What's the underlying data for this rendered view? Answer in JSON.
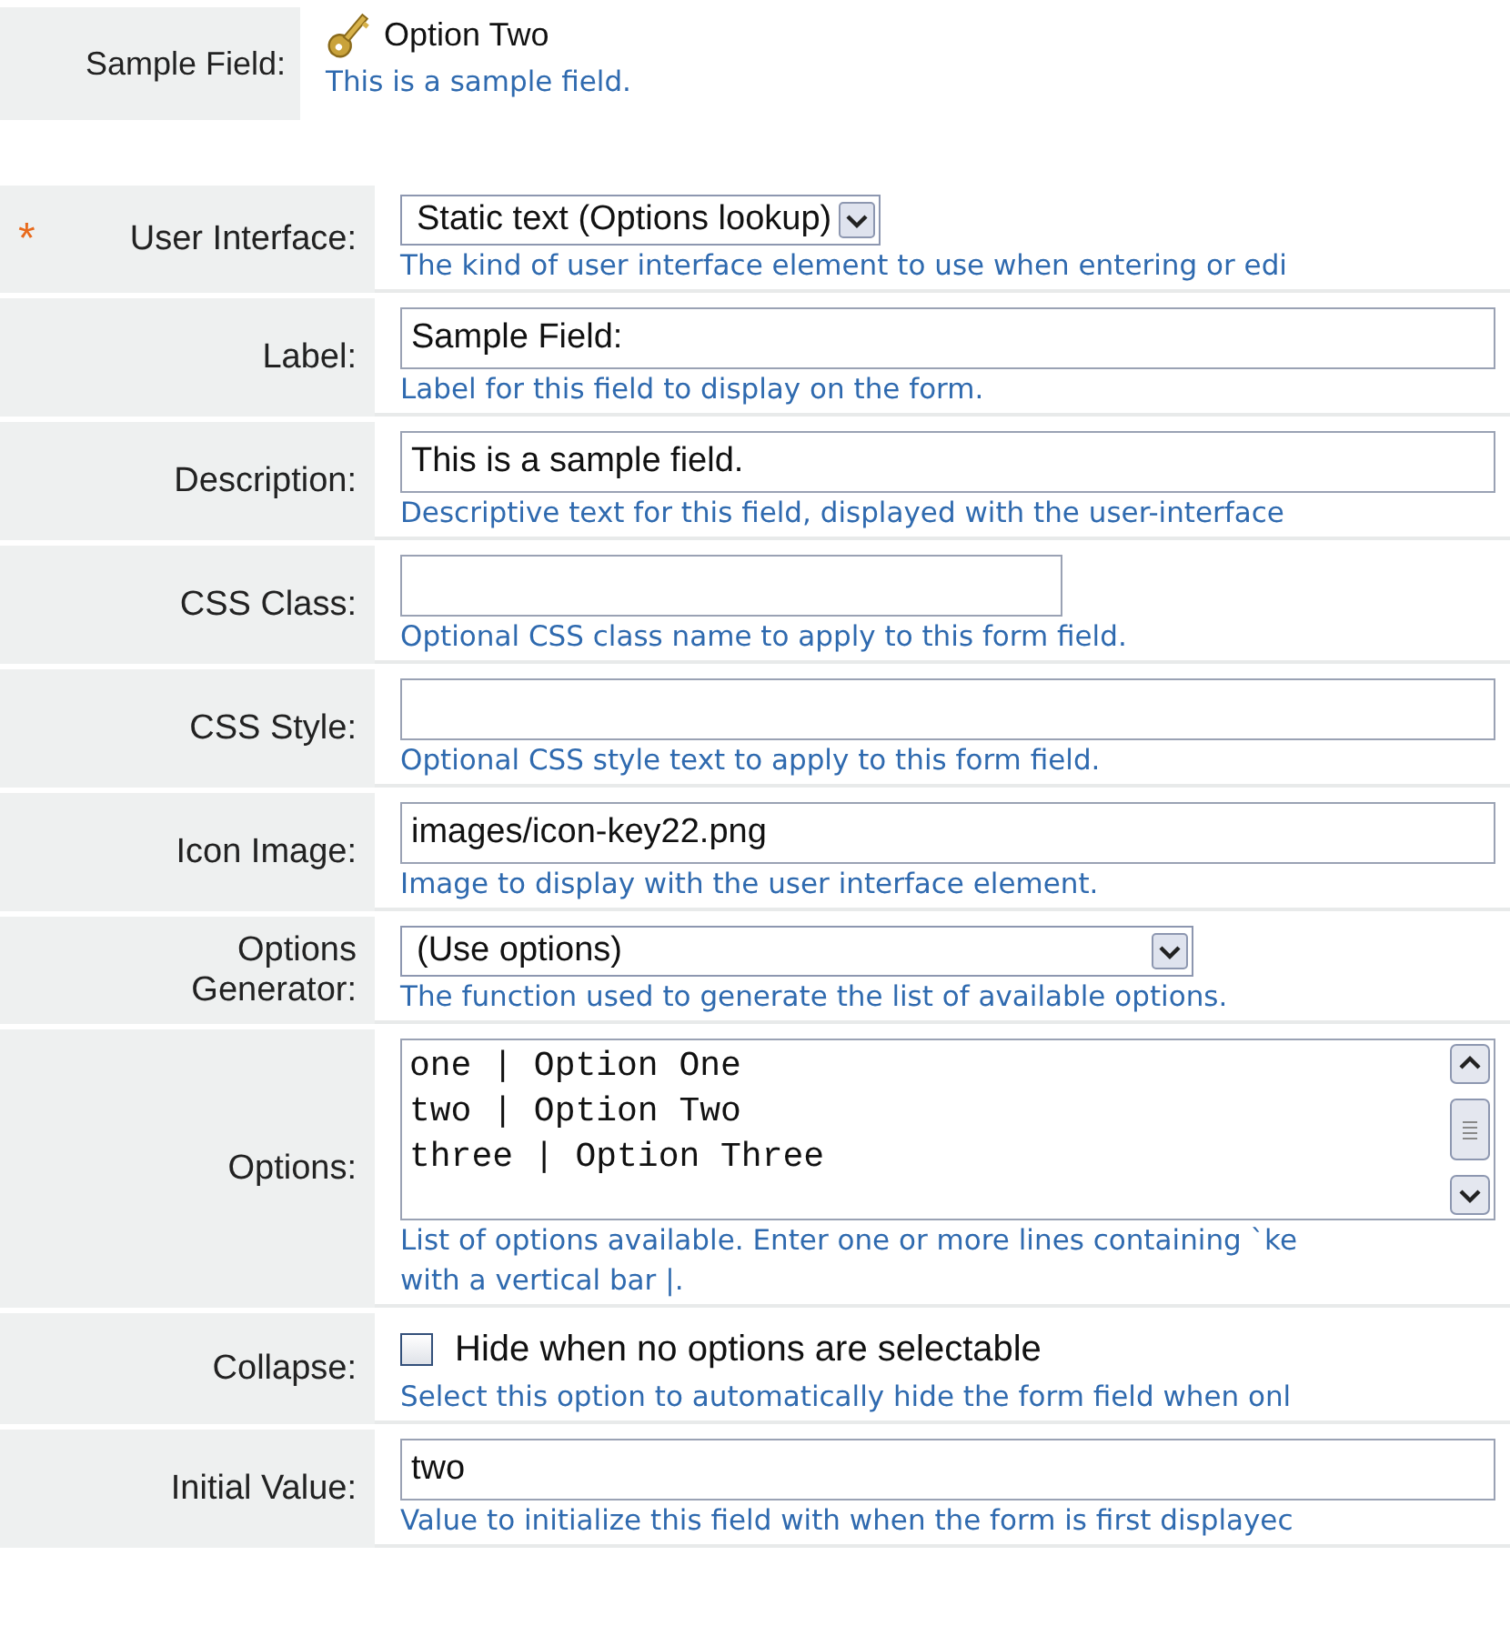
{
  "preview": {
    "label": "Sample Field:",
    "value": "Option Two",
    "hint": "This is a sample field."
  },
  "rows": [
    {
      "kind": "select",
      "label": "User Interface:",
      "required_mark": "*",
      "value": "Static text (Options lookup)",
      "hint": "The kind of user interface element to use when entering or edi"
    },
    {
      "kind": "text",
      "label": "Label:",
      "value": "Sample Field:",
      "hint": "Label for this field to display on the form."
    },
    {
      "kind": "text",
      "label": "Description:",
      "value": "This is a sample field.",
      "hint": "Descriptive text for this field, displayed with the user-interface"
    },
    {
      "kind": "short-text",
      "label": "CSS Class:",
      "value": "",
      "hint": "Optional CSS class name to apply to this form field."
    },
    {
      "kind": "text",
      "label": "CSS Style:",
      "value": "",
      "hint": "Optional CSS style text to apply to this form field."
    },
    {
      "kind": "text",
      "label": "Icon Image:",
      "value": "images/icon-key22.png",
      "hint": "Image to display with the user interface element."
    },
    {
      "kind": "wide-select",
      "label": "Options Generator:",
      "value": "(Use options)",
      "hint": "The function used to generate the list of available options."
    },
    {
      "kind": "textarea",
      "label": "Options:",
      "lines": [
        "one | Option One",
        "two | Option Two",
        "three | Option Three"
      ],
      "hint": "List of options available. Enter one or more lines containing `ke",
      "hint2": "with a vertical bar |."
    },
    {
      "kind": "checkbox",
      "label": "Collapse:",
      "checked": false,
      "value": "Hide when no options are selectable",
      "hint": "Select this option to automatically hide the form field when onl"
    },
    {
      "kind": "text",
      "label": "Initial Value:",
      "value": "two",
      "hint": "Value to initialize this field with when the form is first displayec"
    }
  ]
}
